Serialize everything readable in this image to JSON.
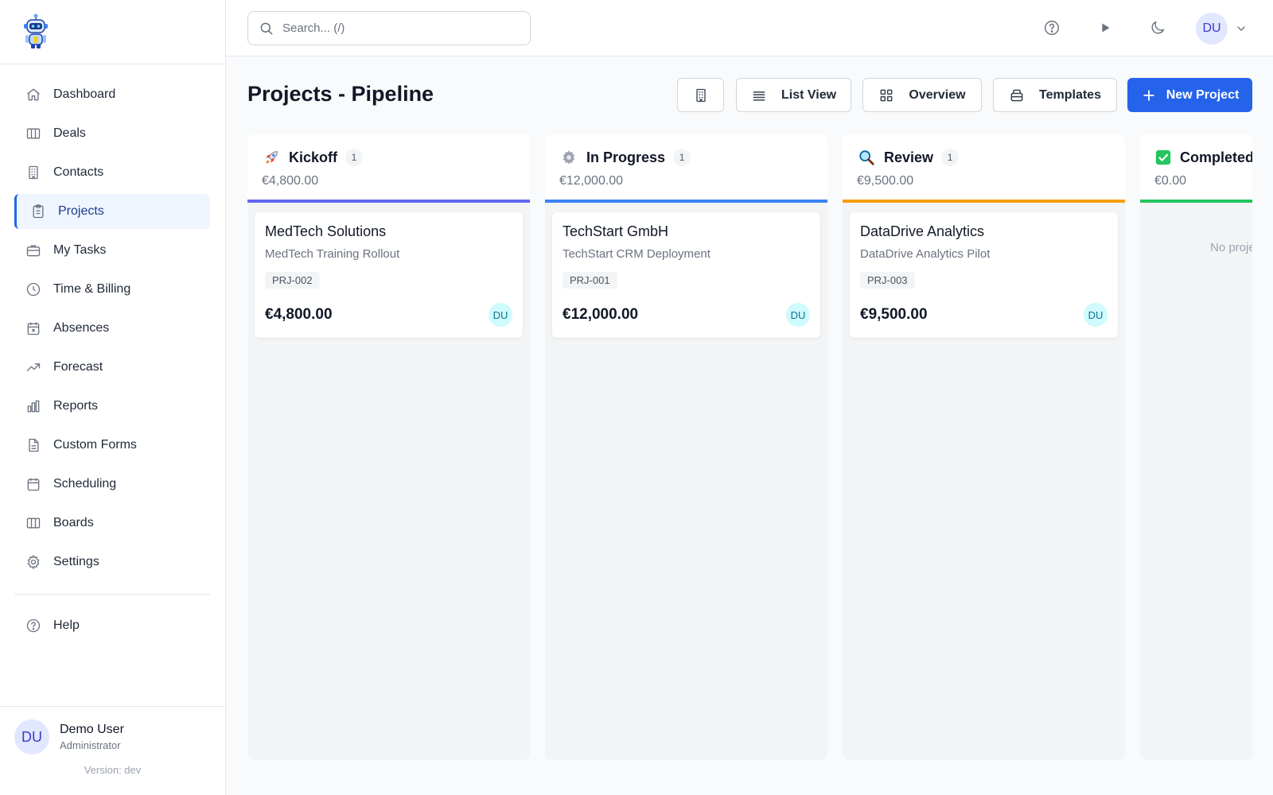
{
  "sidebar": {
    "items": [
      {
        "label": "Dashboard"
      },
      {
        "label": "Deals"
      },
      {
        "label": "Contacts"
      },
      {
        "label": "Projects"
      },
      {
        "label": "My Tasks"
      },
      {
        "label": "Time & Billing"
      },
      {
        "label": "Absences"
      },
      {
        "label": "Forecast"
      },
      {
        "label": "Reports"
      },
      {
        "label": "Custom Forms"
      },
      {
        "label": "Scheduling"
      },
      {
        "label": "Boards"
      },
      {
        "label": "Settings"
      }
    ],
    "help": "Help",
    "user": {
      "initials": "DU",
      "name": "Demo User",
      "role": "Administrator"
    },
    "version": "Version: dev"
  },
  "topbar": {
    "search_placeholder": "Search... (/)",
    "avatar_initials": "DU"
  },
  "page": {
    "title": "Projects - Pipeline",
    "buttons": {
      "list_view": "List View",
      "overview": "Overview",
      "templates": "Templates",
      "new_project": "New Project"
    }
  },
  "columns": [
    {
      "title": "Kickoff",
      "count": "1",
      "total": "€4,800.00",
      "accent": "#6366f1",
      "card": {
        "company": "MedTech Solutions",
        "project": "MedTech Training Rollout",
        "id": "PRJ-002",
        "amount": "€4,800.00",
        "owner": "DU"
      }
    },
    {
      "title": "In Progress",
      "count": "1",
      "total": "€12,000.00",
      "accent": "#3b82f6",
      "card": {
        "company": "TechStart GmbH",
        "project": "TechStart CRM Deployment",
        "id": "PRJ-001",
        "amount": "€12,000.00",
        "owner": "DU"
      }
    },
    {
      "title": "Review",
      "count": "1",
      "total": "€9,500.00",
      "accent": "#f59e0b",
      "card": {
        "company": "DataDrive Analytics",
        "project": "DataDrive Analytics Pilot",
        "id": "PRJ-003",
        "amount": "€9,500.00",
        "owner": "DU"
      }
    },
    {
      "title": "Completed",
      "total": "€0.00",
      "accent": "#22c55e",
      "empty": "No projects"
    }
  ],
  "colors": {
    "primary": "#2563eb",
    "active_bg": "#eff6ff"
  }
}
